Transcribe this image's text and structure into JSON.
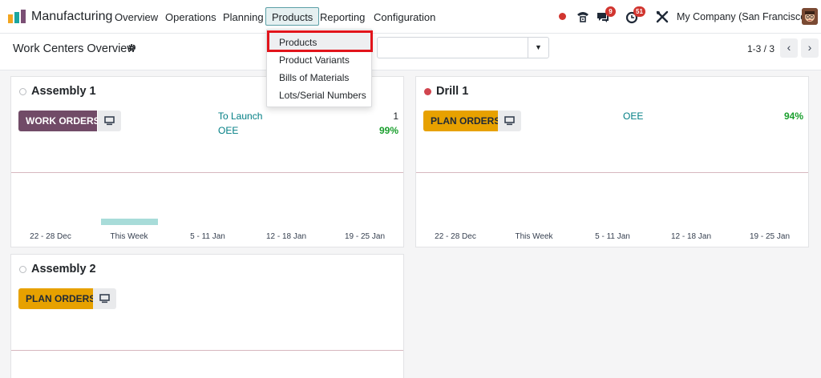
{
  "navbar": {
    "app_name": "Manufacturing",
    "menu": [
      "Overview",
      "Operations",
      "Planning",
      "Products",
      "Reporting",
      "Configuration"
    ],
    "active_menu": "Products",
    "messages_badge": "9",
    "activities_badge": "51",
    "company": "My Company (San Francisco)"
  },
  "control_panel": {
    "title": "Work Centers Overview",
    "pager": "1-3 / 3",
    "search_toggle_icon": "caret-down-icon"
  },
  "products_dropdown": {
    "items": [
      "Products",
      "Product Variants",
      "Bills of Materials",
      "Lots/Serial Numbers"
    ],
    "highlighted": "Products"
  },
  "week_labels": [
    "22 - 28 Dec",
    "This Week",
    "5 - 11 Jan",
    "12 - 18 Jan",
    "19 - 25 Jan"
  ],
  "cards": [
    {
      "name": "Assembly 1",
      "status": "grey",
      "button": "WORK ORDERS",
      "stats": [
        {
          "label": "To Launch",
          "value": "1"
        },
        {
          "label": "OEE",
          "value": "99%"
        }
      ],
      "chart_data": {
        "type": "bar",
        "categories": [
          "22 - 28 Dec",
          "This Week",
          "5 - 11 Jan",
          "12 - 18 Jan",
          "19 - 25 Jan"
        ],
        "values": [
          0,
          1,
          0,
          0,
          0
        ]
      }
    },
    {
      "name": "Drill 1",
      "status": "red",
      "button": "PLAN ORDERS",
      "stats": [
        {
          "label": "OEE",
          "value": "94%"
        }
      ],
      "chart_data": {
        "type": "bar",
        "categories": [
          "22 - 28 Dec",
          "This Week",
          "5 - 11 Jan",
          "12 - 18 Jan",
          "19 - 25 Jan"
        ],
        "values": [
          0,
          0,
          0,
          0,
          0
        ]
      }
    },
    {
      "name": "Assembly 2",
      "status": "grey",
      "button": "PLAN ORDERS"
    }
  ],
  "colors": {
    "brand": "#714b67",
    "plan_button": "#e7a100",
    "link_teal": "#017e84",
    "success": "#1a9f2d",
    "annotation_red": "#e2141b"
  }
}
